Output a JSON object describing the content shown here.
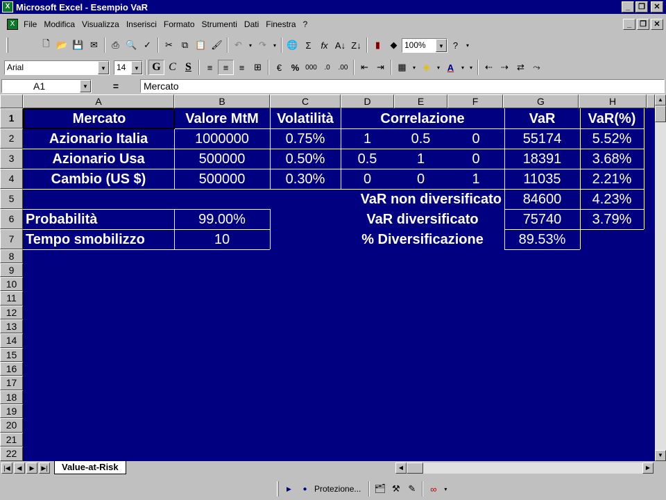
{
  "window": {
    "title": "Microsoft Excel - Esempio VaR",
    "app_icon": "excel-icon"
  },
  "menu": [
    "File",
    "Modifica",
    "Visualizza",
    "Inserisci",
    "Formato",
    "Strumenti",
    "Dati",
    "Finestra",
    "?"
  ],
  "toolbar": {
    "zoom": "100%",
    "font_name": "Arial",
    "font_size": "14",
    "sigma": "Σ",
    "fx": "fx",
    "bold": "G",
    "italic": "C",
    "underline": "S",
    "percent": "%",
    "thousands": "000"
  },
  "formula_bar": {
    "cell_ref": "A1",
    "equals": "=",
    "content": "Mercato"
  },
  "columns": [
    "A",
    "B",
    "C",
    "D",
    "E",
    "F",
    "G",
    "H"
  ],
  "rows": [
    "1",
    "2",
    "3",
    "4",
    "5",
    "6",
    "7",
    "8",
    "9",
    "10",
    "11",
    "12",
    "13",
    "14",
    "15",
    "16",
    "17",
    "18",
    "19",
    "20",
    "21",
    "22"
  ],
  "table": {
    "header": {
      "mercato": "Mercato",
      "valore": "Valore MtM",
      "volatilita": "Volatilità",
      "correlazione": "Correlazione",
      "var": "VaR",
      "var_pct": "VaR(%)"
    },
    "assets": [
      {
        "name": "Azionario Italia",
        "valore": "1000000",
        "vol": "0.75%",
        "c1": "1",
        "c2": "0.5",
        "c3": "0",
        "var": "55174",
        "var_pct": "5.52%"
      },
      {
        "name": "Azionario Usa",
        "valore": "500000",
        "vol": "0.50%",
        "c1": "0.5",
        "c2": "1",
        "c3": "0",
        "var": "18391",
        "var_pct": "3.68%"
      },
      {
        "name": "Cambio (US $)",
        "valore": "500000",
        "vol": "0.30%",
        "c1": "0",
        "c2": "0",
        "c3": "1",
        "var": "11035",
        "var_pct": "2.21%"
      }
    ],
    "summary": {
      "non_div_label": "VaR non diversificato",
      "non_div_value": "84600",
      "non_div_pct": "4.23%",
      "div_label": "VaR diversificato",
      "div_value": "75740",
      "div_pct": "3.79%",
      "pct_div_label": "% Diversificazione",
      "pct_div_value": "89.53%"
    },
    "params": {
      "prob_label": "Probabilità",
      "prob_value": "99.00%",
      "tempo_label": "Tempo smobilizzo",
      "tempo_value": "10"
    }
  },
  "sheet_tab": "Value-at-Risk",
  "drawing": {
    "protezione": "Protezione..."
  }
}
